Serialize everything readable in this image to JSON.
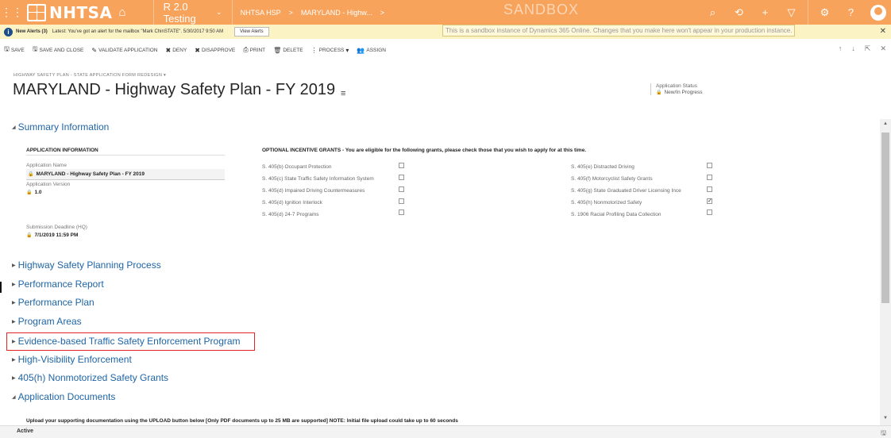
{
  "navbar": {
    "logo_text": "NHTSA",
    "app_name": "R 2.0 Testing",
    "crumb_1": "NHTSA HSP",
    "crumb_sep": ">",
    "crumb_2": "MARYLAND - Highw...",
    "crumb_more": ">",
    "sandbox_label": "SANDBOX"
  },
  "alerts": {
    "title": "New Alerts (3)",
    "message": "Latest: You've got an alert for the mailbox \"Mark ChinSTATE\". 5/30/2017 9:50 AM",
    "view_button": "View Alerts",
    "sandbox_message": "This is a sandbox instance of Dynamics 365 Online. Changes that you make here won't appear in your production instance.",
    "close": "✕"
  },
  "toolbar": {
    "save": "SAVE",
    "save_close": "SAVE AND CLOSE",
    "validate": "VALIDATE APPLICATION",
    "deny": "DENY",
    "disapprove": "DISAPPROVE",
    "print": "PRINT",
    "delete": "DELETE",
    "process": "PROCESS",
    "assign": "ASSIGN"
  },
  "header": {
    "form_selector": "HIGHWAY SAFETY PLAN - STATE APPLICATION FORM REDESIGN",
    "title": "MARYLAND - Highway Safety Plan - FY 2019",
    "status_label": "Application Status",
    "status_value": "New/In Progress"
  },
  "sections": {
    "summary": "Summary Information",
    "planning": "Highway Safety Planning Process",
    "performance_report": "Performance Report",
    "performance_plan": "Performance Plan",
    "program_areas": "Program Areas",
    "evidence": "Evidence-based Traffic Safety Enforcement Program",
    "hve": "High-Visibility Enforcement",
    "h405": "405(h) Nonmotorized Safety Grants",
    "documents": "Application Documents"
  },
  "app_info": {
    "header": "APPLICATION INFORMATION",
    "name_label": "Application Name",
    "name_value": "MARYLAND - Highway Safety Plan - FY 2019",
    "version_label": "Application Version",
    "version_value": "1.0",
    "deadline_label": "Submission Deadline (HQ)",
    "deadline_value": "7/1/2019  11:59 PM"
  },
  "grants": {
    "header": "OPTIONAL INCENTIVE GRANTS - You are eligible for the following grants, please check those that you wish to apply for at this time.",
    "left": [
      {
        "label": "S. 405(b) Occupant Protection",
        "checked": false
      },
      {
        "label": "S. 405(c) State Traffic Safety Information System",
        "checked": false
      },
      {
        "label": "S. 405(d) Impaired Driving Countermeasures",
        "checked": false
      },
      {
        "label": "S. 405(d) Ignition Interlock",
        "checked": false
      },
      {
        "label": "S. 405(d) 24-7 Programs",
        "checked": false
      }
    ],
    "right": [
      {
        "label": "S. 405(e) Distracted Driving",
        "checked": false
      },
      {
        "label": "S. 405(f) Motorcyclist Safety Grants",
        "checked": false
      },
      {
        "label": "S. 405(g) State Graduated Driver Licensing Ince",
        "checked": false
      },
      {
        "label": "S. 405(h) Nonmotorized Safety",
        "checked": true
      },
      {
        "label": "S. 1906 Racial Profiling Data Collection",
        "checked": false
      }
    ]
  },
  "documents": {
    "upload_text": "Upload your supporting documentation using the UPLOAD button below [Only PDF documents up to 25 MB are supported] NOTE: Initial file upload could take up to 60 seconds"
  },
  "statusbar": {
    "state": "Active"
  }
}
